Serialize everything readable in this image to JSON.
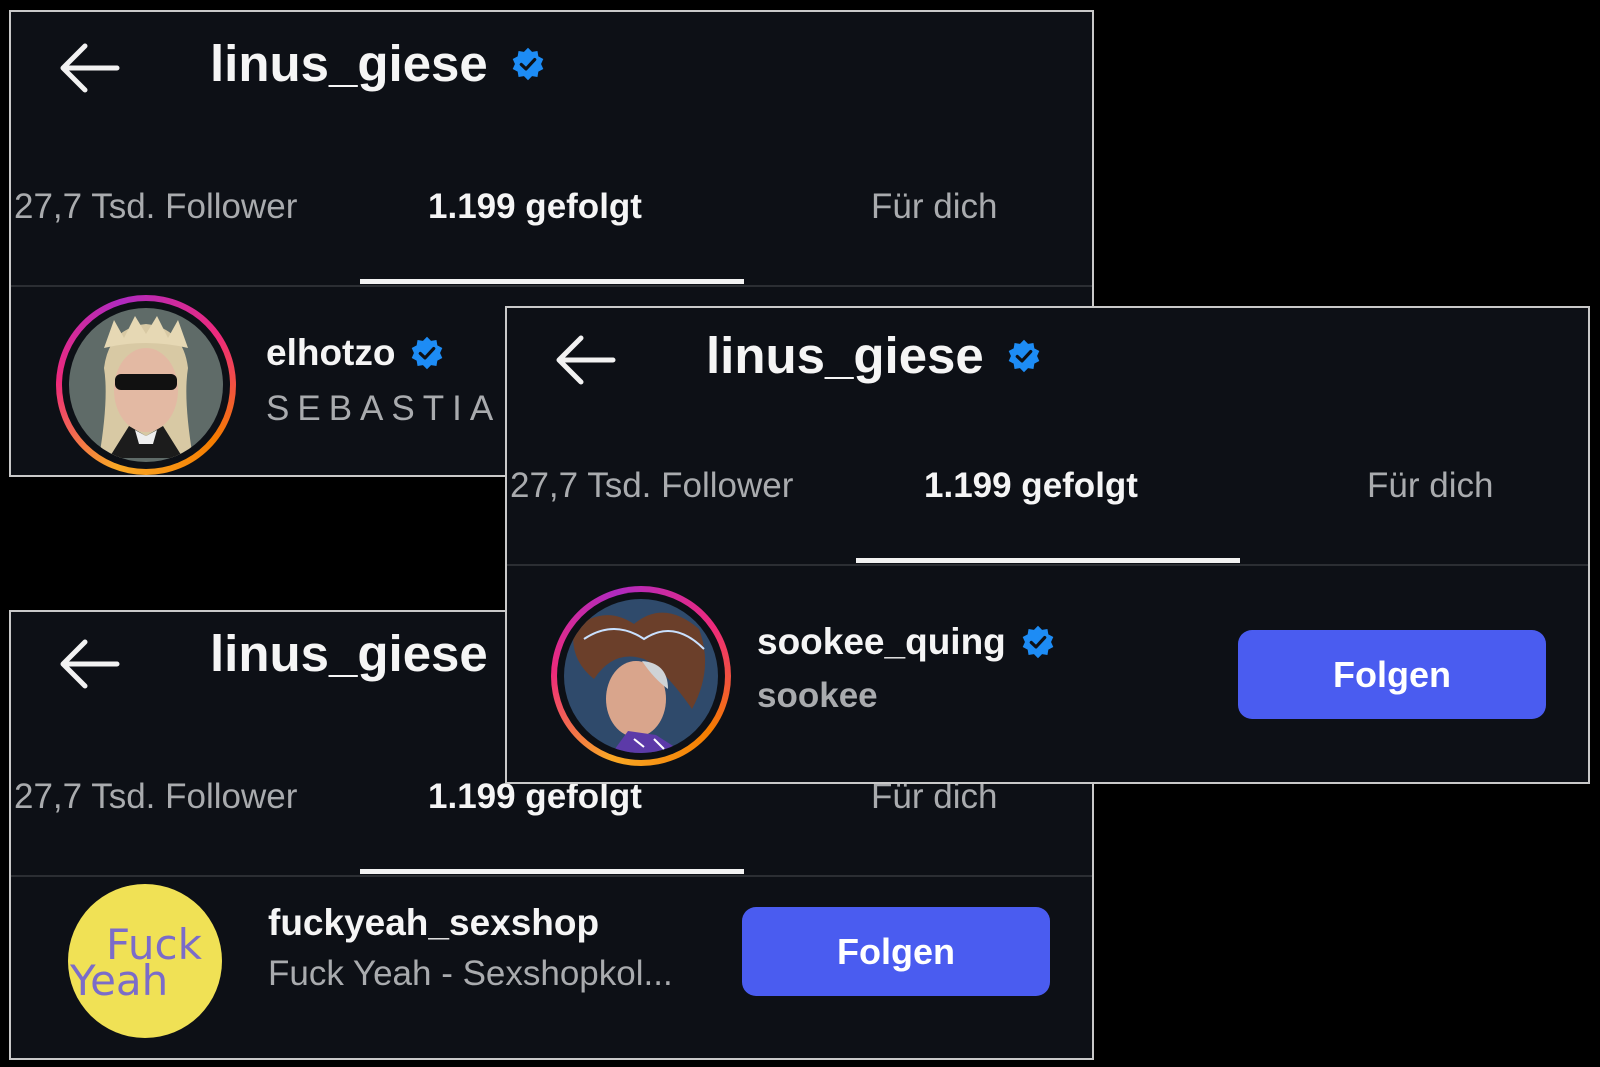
{
  "colors": {
    "background": "#000000",
    "panel": "#0d1016",
    "accent_button": "#4a5cf0",
    "verified_badge": "#1d8cf5",
    "muted_text": "#a9abae"
  },
  "panels": [
    {
      "back_icon": "arrow-left-icon",
      "title": "linus_giese",
      "tabs": [
        "27,7 Tsd. Follower",
        "1.199 gefolgt",
        "Für dich"
      ],
      "active_tab": 1,
      "user": {
        "username": "elhotzo",
        "verified": true,
        "subtitle": "SEBASTIA"
      }
    },
    {
      "back_icon": "arrow-left-icon",
      "title": "linus_giese",
      "tabs": [
        "27,7 Tsd. Follower",
        "1.199 gefolgt",
        "Für dich"
      ],
      "active_tab": 1,
      "user": {
        "username": "fuckyeah_sexshop",
        "verified": false,
        "subtitle": "Fuck Yeah - Sexshopkol...",
        "logo_line1": "Fuck",
        "logo_line2": "Yeah",
        "follow_label": "Folgen"
      }
    },
    {
      "back_icon": "arrow-left-icon",
      "title": "linus_giese",
      "tabs": [
        "27,7 Tsd. Follower",
        "1.199 gefolgt",
        "Für dich"
      ],
      "active_tab": 1,
      "user": {
        "username": "sookee_quing",
        "verified": true,
        "subtitle": "sookee",
        "follow_label": "Folgen"
      }
    }
  ]
}
